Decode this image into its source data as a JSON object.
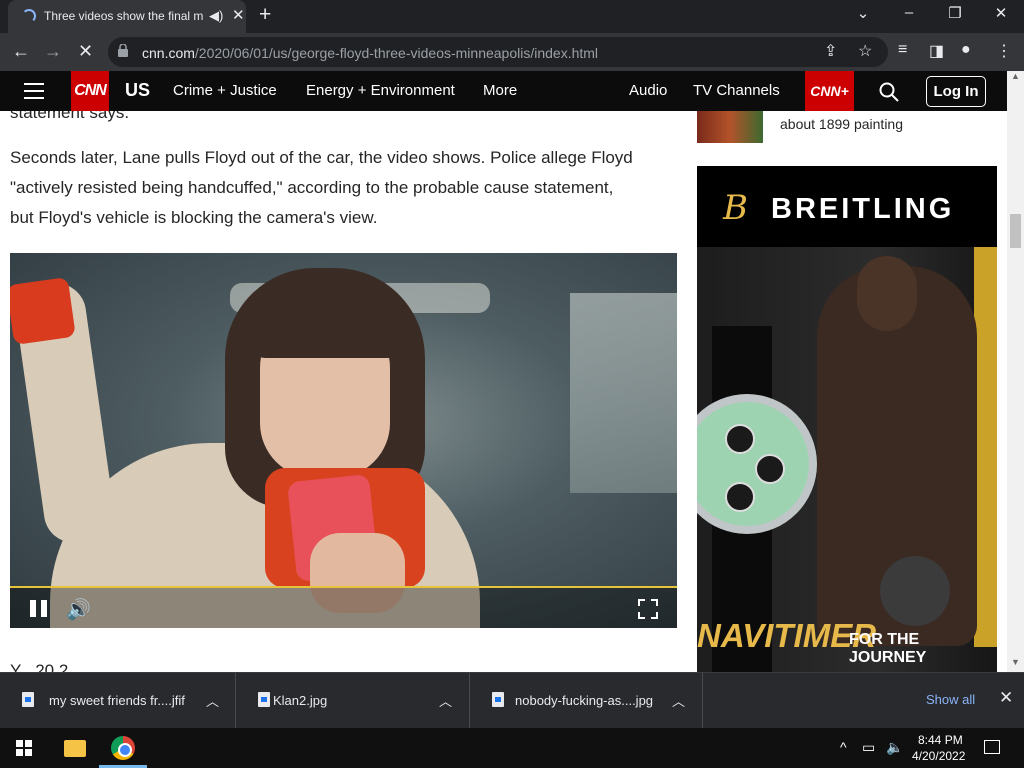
{
  "browser": {
    "tab_title": "Three videos show the final m",
    "url_host": "cnn.com",
    "url_path": "/2020/06/01/us/george-floyd-three-videos-minneapolis/index.html",
    "icons": [
      "back-icon",
      "forward-icon",
      "stop-icon",
      "lock-icon",
      "share-icon",
      "star-icon",
      "media-icon",
      "sidepanel-icon",
      "profile-icon",
      "menu-icon"
    ]
  },
  "cnn_nav": {
    "logo": "CNN",
    "section": "US",
    "links": [
      "Crime + Justice",
      "Energy + Environment",
      "More"
    ],
    "right_links": [
      "Audio",
      "TV Channels"
    ],
    "cnn_plus": "CNN+",
    "login": "Log In"
  },
  "article": {
    "line_top": "statement says.",
    "para": [
      "Seconds later, Lane pulls Floyd out of the car, the video shows. Police allege Floyd",
      "\"actively resisted being handcuffed,\" according to the probable cause statement,",
      "but Floyd's vehicle is blocking the camera's view."
    ],
    "next_para": "Y                                                                     , 20 2 ."
  },
  "video": {
    "progress": 1.0,
    "progress_color": "#e6c33b"
  },
  "sidebar": {
    "related_text": "about 1899 painting",
    "ad_brand": "BREITLING",
    "ad_logo": "B",
    "ad_tagline_big": "NAVITIMER",
    "ad_tagline_small": "FOR THE JOURNEY"
  },
  "downloads": {
    "items": [
      {
        "name": "my sweet friends fr....jfif"
      },
      {
        "name": "Klan2.jpg"
      },
      {
        "name": "nobody-fucking-as....jpg"
      }
    ],
    "show_all": "Show all"
  },
  "taskbar": {
    "time": "8:44 PM",
    "date": "4/20/2022"
  }
}
